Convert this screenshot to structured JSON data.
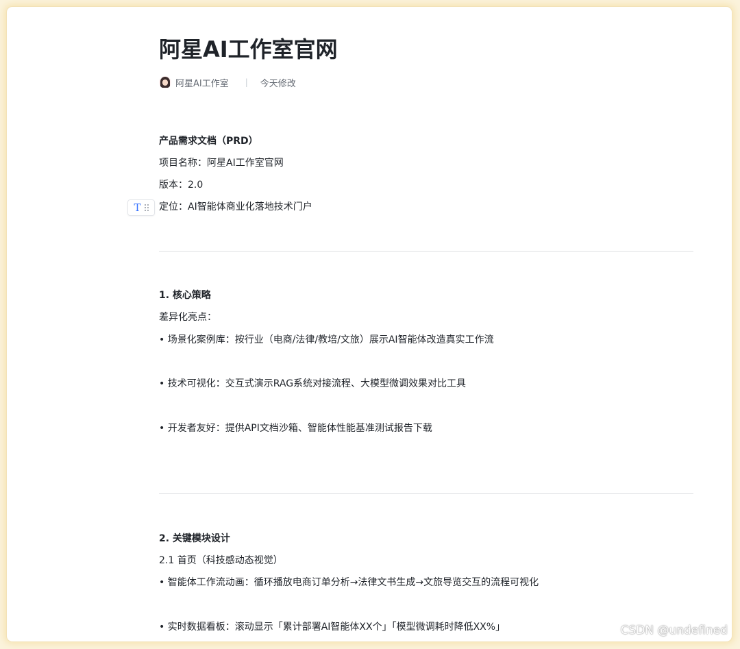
{
  "document": {
    "title": "阿星AI工作室官网",
    "author": "阿星AI工作室",
    "modified": "今天修改"
  },
  "toolbar": {
    "block_type_icon": "T",
    "drag_handle_icon": "drag-handle-icon"
  },
  "body": {
    "prd_heading": "产品需求文档（PRD）",
    "project_name": "项目名称：阿星AI工作室官网",
    "version": "版本：2.0",
    "positioning": "定位：AI智能体商业化落地技术门户",
    "section1_heading": "1. 核心策略",
    "section1_subheading": "差异化亮点：",
    "section1_bullets": [
      "• 场景化案例库：按行业（电商/法律/教培/文旅）展示AI智能体改造真实工作流",
      "• 技术可视化：交互式演示RAG系统对接流程、大模型微调效果对比工具",
      "• 开发者友好：提供API文档沙箱、智能体性能基准测试报告下载"
    ],
    "section2_heading": "2. 关键模块设计",
    "section2_subheading": "2.1 首页（科技感动态视觉）",
    "section2_bullets": [
      "• 智能体工作流动画：循环播放电商订单分析→法律文书生成→文旅导览交互的流程可视化",
      "• 实时数据看板：滚动显示「累计部署AI智能体XX个」「模型微调耗时降低XX%」"
    ]
  },
  "watermark": "CSDN @undefined",
  "colors": {
    "accent": "#3370ff",
    "text": "#1f2329",
    "muted": "#646a73",
    "divider": "#dee0e3",
    "frame_glow": "#f6e4b4"
  }
}
